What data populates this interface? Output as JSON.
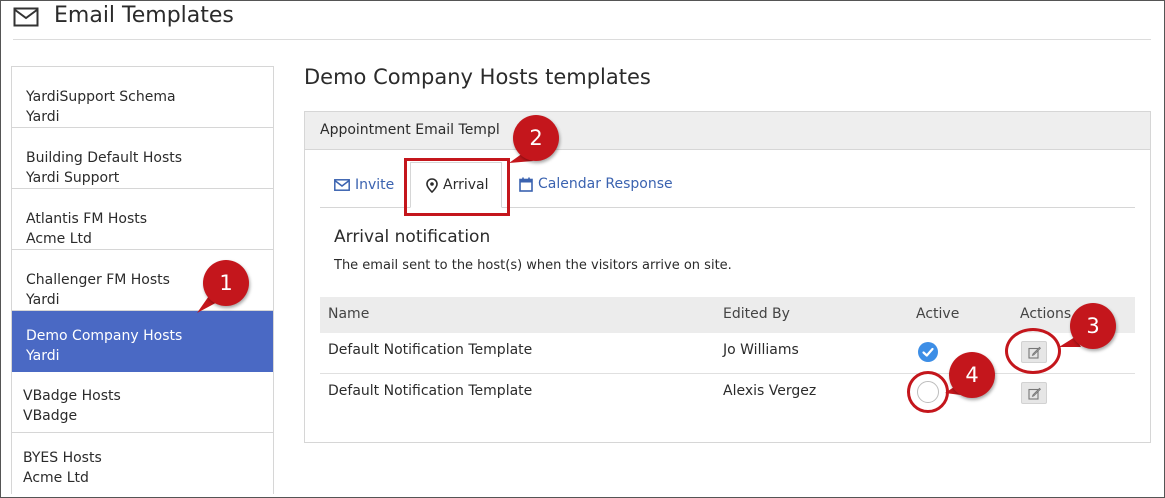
{
  "header": {
    "title": "Email Templates",
    "icon": "envelope-icon"
  },
  "sidebar": {
    "items": [
      {
        "name": "YardiSupport Schema",
        "owner": "Yardi",
        "active": false
      },
      {
        "name": "Building Default Hosts",
        "owner": "Yardi Support",
        "active": false
      },
      {
        "name": "Atlantis FM Hosts",
        "owner": "Acme Ltd",
        "active": false
      },
      {
        "name": "Challenger FM Hosts",
        "owner": "Yardi",
        "active": false
      },
      {
        "name": "Demo Company Hosts",
        "owner": "Yardi",
        "active": true
      },
      {
        "name": "VBadge Hosts",
        "owner": "VBadge",
        "active": false
      },
      {
        "name": "BYES Hosts",
        "owner": "Acme Ltd",
        "active": false
      }
    ]
  },
  "main": {
    "title": "Demo Company Hosts templates",
    "panel_title": "Appointment Email Templ",
    "tabs": [
      {
        "label": "Invite",
        "icon": "envelope-icon",
        "selected": false
      },
      {
        "label": "Arrival",
        "icon": "map-pin-icon",
        "selected": true
      },
      {
        "label": "Calendar Response",
        "icon": "calendar-icon",
        "selected": false
      }
    ],
    "section_title": "Arrival notification",
    "section_desc": "The email sent to the host(s) when the visitors arrive on site.",
    "table": {
      "columns": [
        "Name",
        "Edited By",
        "Active",
        "Actions"
      ],
      "rows": [
        {
          "name": "Default Notification Template",
          "edited_by": "Jo Williams",
          "active": true
        },
        {
          "name": "Default Notification Template",
          "edited_by": "Alexis Vergez",
          "active": false
        }
      ]
    }
  },
  "callouts": [
    "1",
    "2",
    "3",
    "4"
  ],
  "colors": {
    "accent": "#4a69c4",
    "link": "#3b63b0",
    "callout": "#c4161c",
    "check": "#3d8ee6"
  }
}
